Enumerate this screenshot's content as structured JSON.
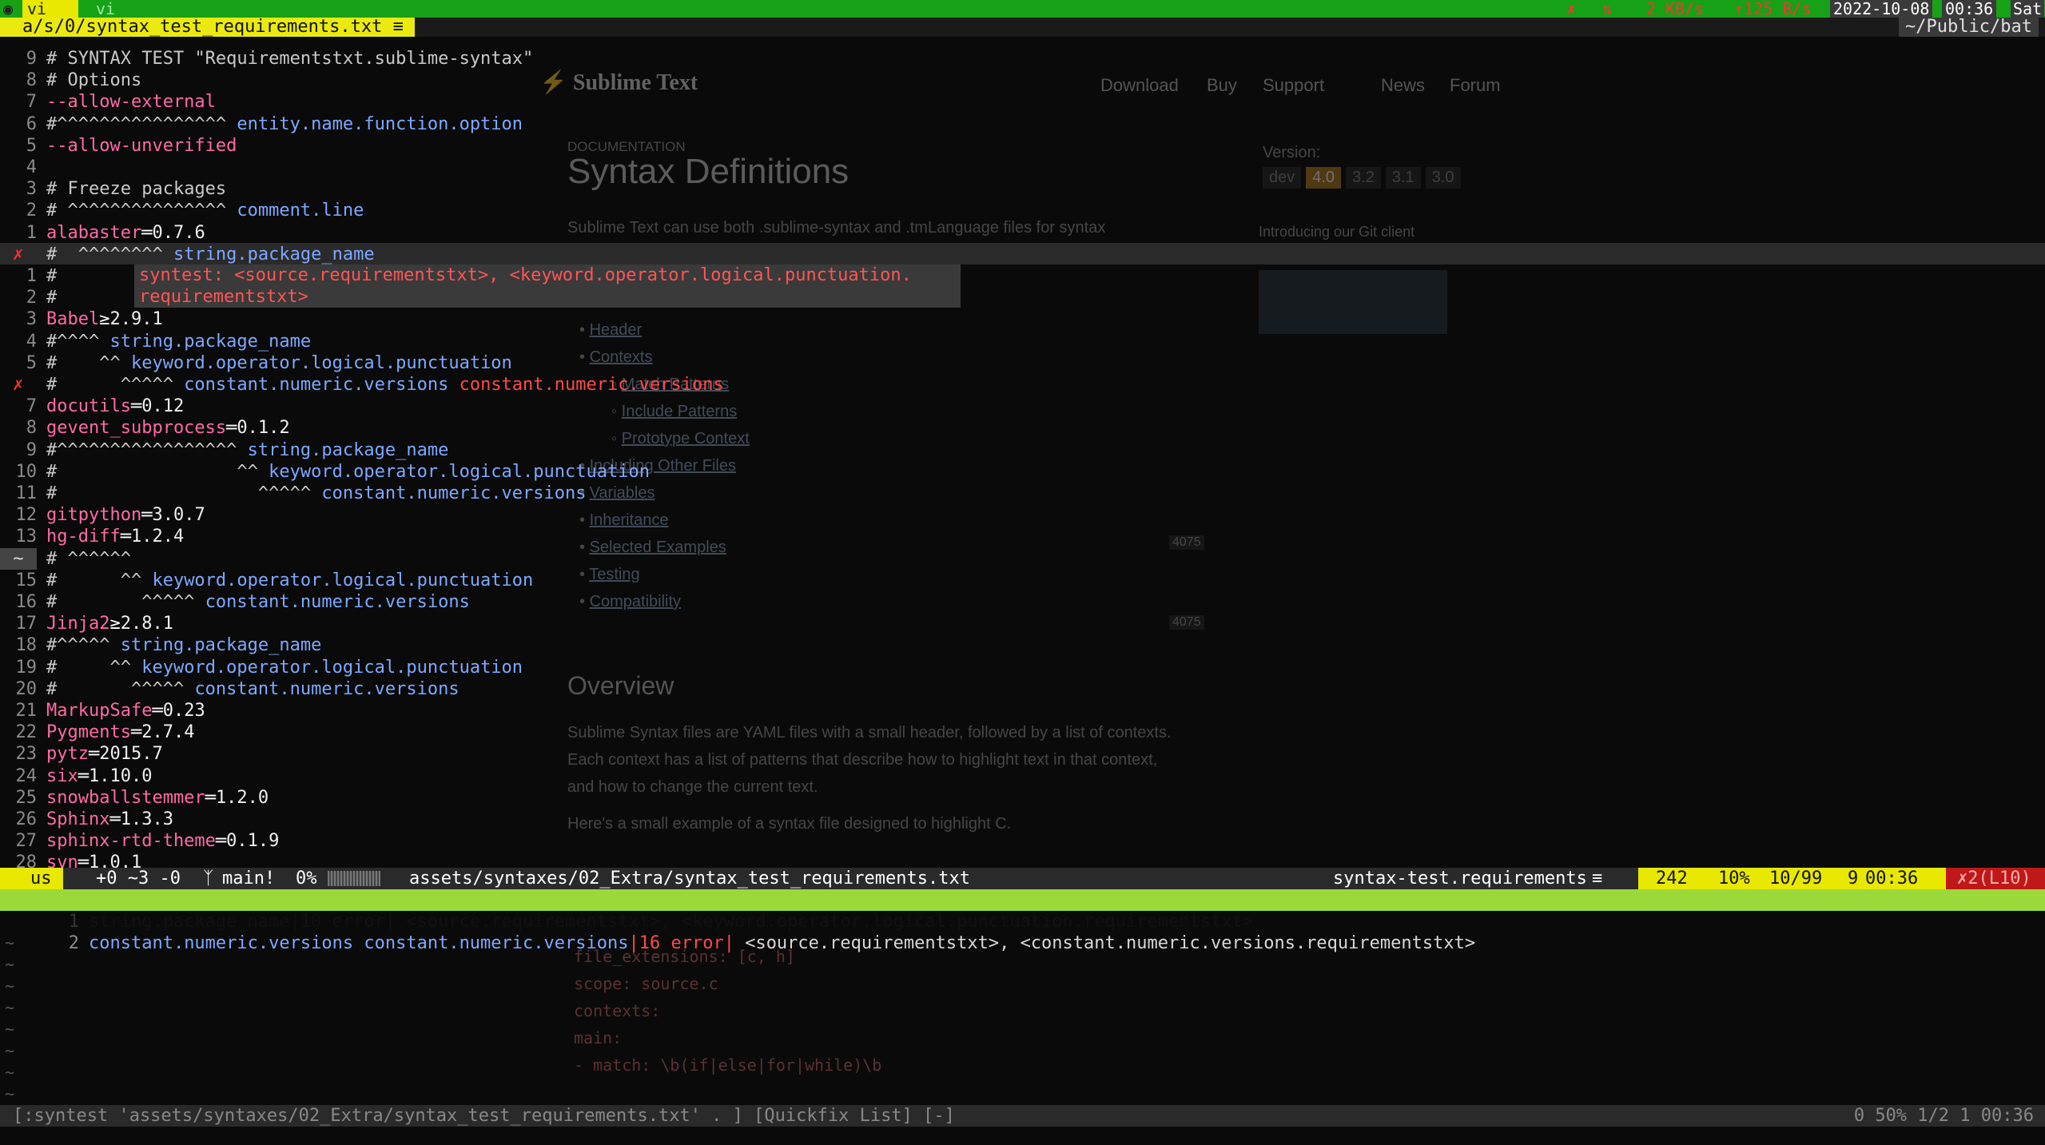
{
  "topbar": {
    "workspaces": [
      "⊚",
      "①",
      "vi",
      "vi"
    ],
    "net_down": "2 KB/s",
    "net_up": "125 B/s",
    "date": "2022-10-08",
    "time": "00:36",
    "day": "Sat",
    "colors": {
      "bar": "#1aa81a",
      "tab": "#e6e600"
    }
  },
  "tabline": {
    "buffer": "a/s/0/syntax_test_requirements.txt",
    "cwd": "~/Public/bat"
  },
  "webpage": {
    "brand": "Sublime Text",
    "nav": [
      "Download",
      "Buy",
      "Support",
      "News",
      "Forum"
    ],
    "section": "DOCUMENTATION",
    "title": "Syntax Definitions",
    "intro": "Sublime Text can use both .sublime-syntax and .tmLanguage files for syntax",
    "version_label": "Version:",
    "versions": [
      "dev",
      "4.0",
      "3.2",
      "3.1",
      "3.0"
    ],
    "promo": "Introducing our Git client",
    "toc": [
      "Header",
      "Contexts",
      "Match Patterns",
      "Include Patterns",
      "Prototype Context",
      "Including Other Files",
      "Variables",
      "Inheritance",
      "Selected Examples",
      "Testing",
      "Compatibility"
    ],
    "build_badge": "4075",
    "overview_title": "Overview",
    "overview_1": "Sublime Syntax files are YAML files with a small header, followed by a list of contexts.",
    "overview_2": "Each context has a list of patterns that describe how to highlight text in that context,",
    "overview_3": "and how to change the current text.",
    "overview_4": "Here's a small example of a syntax file designed to highlight C.",
    "code": [
      "file_extensions: [c, h]",
      "scope: source.c",
      "",
      "contexts:",
      "  main:",
      "    - match: \\b(if|else|for|while)\\b"
    ]
  },
  "editor": {
    "lines": [
      {
        "n": "9",
        "t": "# SYNTAX TEST \"Requirementstxt.sublime-syntax\""
      },
      {
        "n": "8",
        "t": "# Options"
      },
      {
        "n": "7",
        "t": "--allow-external"
      },
      {
        "n": "6",
        "t": "#^^^^^^^^^^^^^^^^ entity.name.function.option"
      },
      {
        "n": "5",
        "t": "--allow-unverified"
      },
      {
        "n": "4",
        "t": ""
      },
      {
        "n": "3",
        "t": "# Freeze packages"
      },
      {
        "n": "2",
        "t": "# ^^^^^^^^^^^^^^^ comment.line"
      },
      {
        "n": "1",
        "t": "alabaster==0.7.6"
      },
      {
        "n": "✗",
        "t": "#  ^^^^^^^^ string.package_name"
      },
      {
        "n": "1",
        "t": "#"
      },
      {
        "n": "2",
        "t": "#"
      },
      {
        "n": "3",
        "t": "Babel>=2.9.1"
      },
      {
        "n": "4",
        "t": "#^^^^ string.package_name"
      },
      {
        "n": "5",
        "t": "#    ^^ keyword.operator.logical.punctuation"
      },
      {
        "n": "✗",
        "t": "#      ^^^^^ constant.numeric.versions constant.numeric.versions"
      },
      {
        "n": "7",
        "t": "docutils==0.12"
      },
      {
        "n": "8",
        "t": "gevent_subprocess==0.1.2"
      },
      {
        "n": "9",
        "t": "#^^^^^^^^^^^^^^^^^ string.package_name"
      },
      {
        "n": "10",
        "t": "#                 ^^ keyword.operator.logical.punctuation"
      },
      {
        "n": "11",
        "t": "#                   ^^^^^ constant.numeric.versions"
      },
      {
        "n": "12",
        "t": "gitpython==3.0.7"
      },
      {
        "n": "13",
        "t": "hg-diff==1.2.4"
      },
      {
        "n": "~",
        "t": "# ^^^^^^"
      },
      {
        "n": "15",
        "t": "#      ^^ keyword.operator.logical.punctuation"
      },
      {
        "n": "16",
        "t": "#        ^^^^^ constant.numeric.versions"
      },
      {
        "n": "17",
        "t": "Jinja2>=2.8.1"
      },
      {
        "n": "18",
        "t": "#^^^^^ string.package_name"
      },
      {
        "n": "19",
        "t": "#     ^^ keyword.operator.logical.punctuation"
      },
      {
        "n": "20",
        "t": "#       ^^^^^ constant.numeric.versions"
      },
      {
        "n": "21",
        "t": "MarkupSafe==0.23"
      },
      {
        "n": "22",
        "t": "Pygments==2.7.4"
      },
      {
        "n": "23",
        "t": "pytz==2015.7"
      },
      {
        "n": "24",
        "t": "six==1.10.0"
      },
      {
        "n": "25",
        "t": "snowballstemmer==1.2.0"
      },
      {
        "n": "26",
        "t": "Sphinx==1.3.3"
      },
      {
        "n": "27",
        "t": "sphinx-rtd-theme==0.1.9"
      },
      {
        "n": "28",
        "t": "svn==1.0.1"
      }
    ],
    "error_popup": [
      "syntest: <source.requirementstxt>, <keyword.operator.logical.punctuation.",
      "requirementstxt>"
    ]
  },
  "statusline": {
    "mode": "us",
    "diff": "+0 ~3 -0",
    "branch": "main!",
    "percent": "0%",
    "file": "assets/syntaxes/02_Extra/syntax_test_requirements.txt",
    "filetype": "syntax-test.requirements",
    "chars": "242",
    "pos": "10%",
    "linecol": "10/99",
    "col": "9",
    "time": "00:36",
    "errors": "✗2(L10)"
  },
  "quickfix": {
    "items": [
      {
        "n": "1",
        "a": "string.package_name",
        "b": "|10 error|",
        "c": " <source.requirementstxt>, <keyword.operator.logical.punctuation.requirementstxt>"
      },
      {
        "n": "2",
        "a": "constant.numeric.versions constant.numeric.versions",
        "b": "|16 error|",
        "c": " <source.requirementstxt>, <constant.numeric.versions.requirementstxt>"
      }
    ],
    "status_left": "[:syntest 'assets/syntaxes/02_Extra/syntax_test_requirements.txt' . ] [Quickfix List] [-]",
    "status_right": "0  50% 1/2 1  00:36"
  }
}
